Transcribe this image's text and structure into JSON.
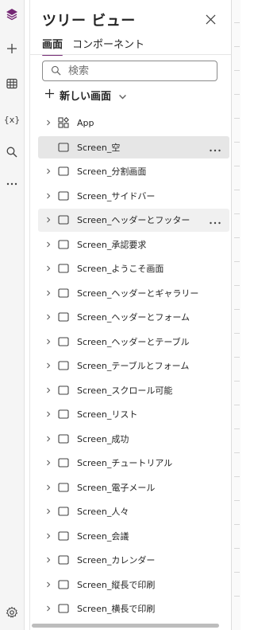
{
  "rail": {
    "items": [
      "layers-icon",
      "plus-icon",
      "table-icon",
      "variable-icon",
      "search-icon",
      "more-icon"
    ],
    "bottom": "settings-icon",
    "variable_label": "{x}"
  },
  "panel": {
    "title": "ツリー ビュー",
    "tabs": [
      "画面",
      "コンポーネント"
    ],
    "search_placeholder": "検索",
    "new_screen_label": "新しい画面"
  },
  "tree": {
    "rows": [
      {
        "label": "App"
      },
      {
        "label": "Screen_空"
      },
      {
        "label": "Screen_分割画面"
      },
      {
        "label": "Screen_サイドバー"
      },
      {
        "label": "Screen_ヘッダーとフッター"
      },
      {
        "label": "Screen_承認要求"
      },
      {
        "label": "Screen_ようこそ画面"
      },
      {
        "label": "Screen_ヘッダーとギャラリー"
      },
      {
        "label": "Screen_ヘッダーとフォーム"
      },
      {
        "label": "Screen_ヘッダーとテーブル"
      },
      {
        "label": "Screen_テーブルとフォーム"
      },
      {
        "label": "Screen_スクロール可能"
      },
      {
        "label": "Screen_リスト"
      },
      {
        "label": "Screen_成功"
      },
      {
        "label": "Screen_チュートリアル"
      },
      {
        "label": "Screen_電子メール"
      },
      {
        "label": "Screen_人々"
      },
      {
        "label": "Screen_会議"
      },
      {
        "label": "Screen_カレンダー"
      },
      {
        "label": "Screen_縦長で印刷"
      },
      {
        "label": "Screen_横長で印刷"
      }
    ]
  },
  "colors": {
    "accent": "#742774",
    "selected_bg": "#e6e6e6"
  }
}
